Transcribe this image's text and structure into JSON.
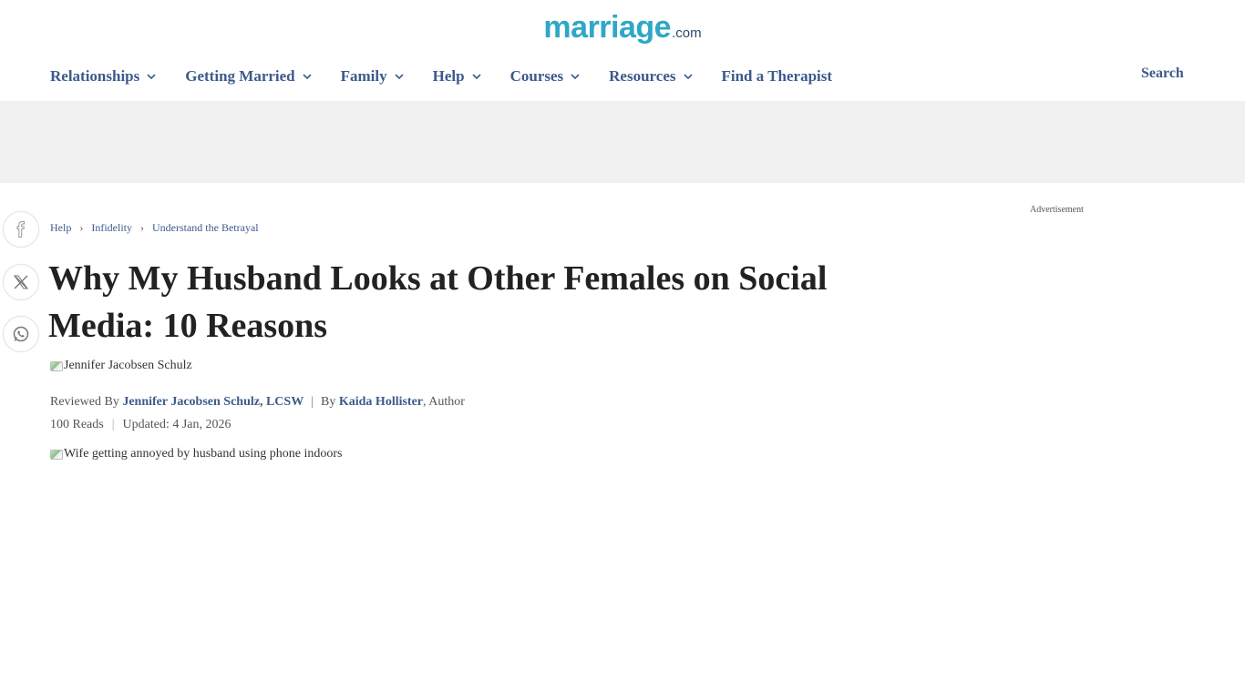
{
  "logo": {
    "main": "marriage",
    "suffix": ".com"
  },
  "nav": {
    "items": [
      {
        "label": "Relationships",
        "has_dropdown": true
      },
      {
        "label": "Getting Married",
        "has_dropdown": true
      },
      {
        "label": "Family",
        "has_dropdown": true
      },
      {
        "label": "Help",
        "has_dropdown": true
      },
      {
        "label": "Courses",
        "has_dropdown": true
      },
      {
        "label": "Resources",
        "has_dropdown": true
      },
      {
        "label": "Find a Therapist",
        "has_dropdown": false
      }
    ],
    "search_label": "Search"
  },
  "share_icons": [
    "facebook-icon",
    "x-icon",
    "whatsapp-icon"
  ],
  "breadcrumb": [
    "Help",
    "Infidelity",
    "Understand the Betrayal"
  ],
  "advertisement_label": "Advertisement",
  "article": {
    "title": "Why My Husband Looks at Other Females on Social Media: 10 Reasons",
    "reviewer_image_alt": "Jennifer Jacobsen Schulz",
    "reviewed_by_prefix": "Reviewed By",
    "reviewer": "Jennifer Jacobsen Schulz, LCSW",
    "by_prefix": "By",
    "author": "Kaida Hollister",
    "author_role": ", Author",
    "reads": "100 Reads",
    "updated": "Updated: 4 Jan, 2026",
    "hero_image_alt": "Wife getting annoyed by husband using phone indoors"
  },
  "colors": {
    "link": "#3d5a8c",
    "logo": "#2fa7c7",
    "ad_band": "#f1f1f1"
  }
}
